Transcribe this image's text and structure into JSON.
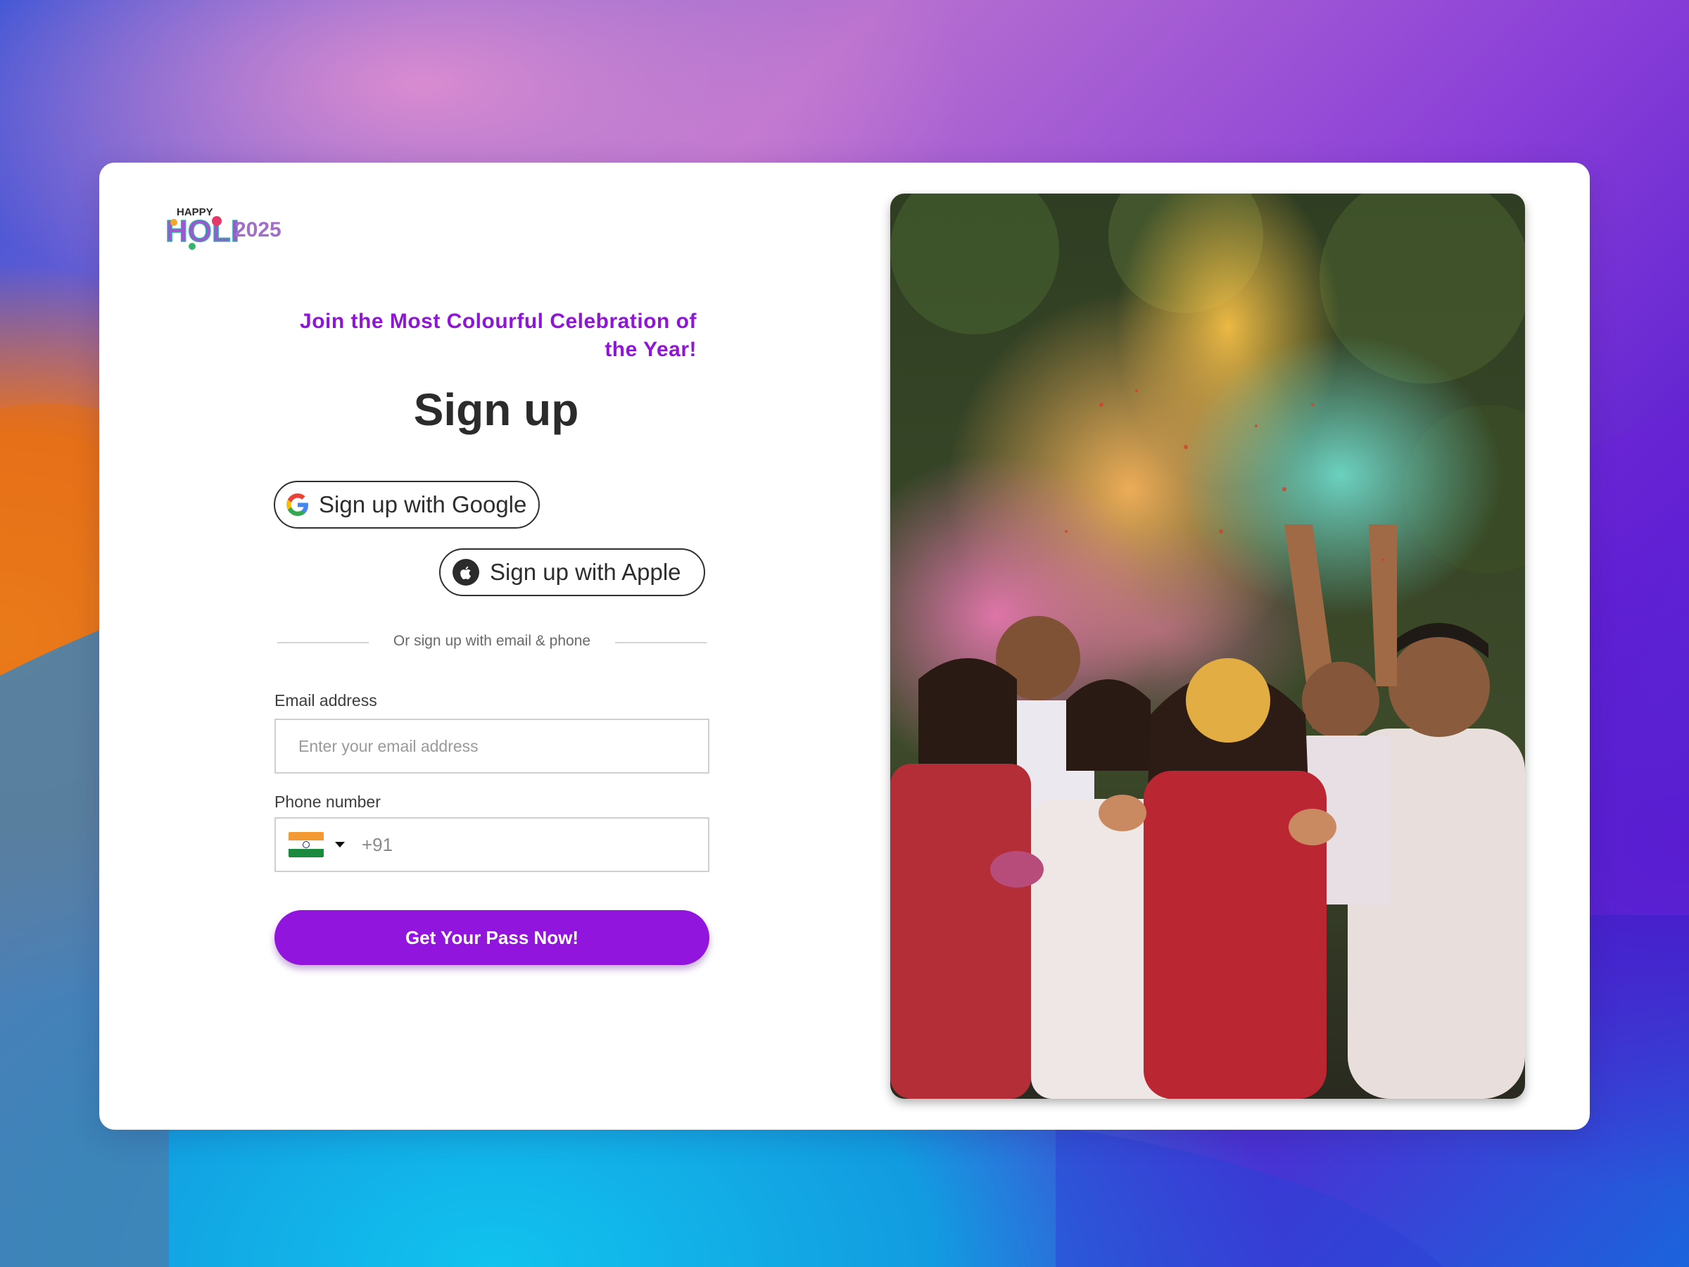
{
  "logo": {
    "happy_text": "HAPPY",
    "holi_text": "HOLI",
    "year_text": "2025"
  },
  "tagline": {
    "line1": "Join the Most Colourful Celebration of",
    "line2": "the Year!"
  },
  "title": "Sign up",
  "social": {
    "google_label": "Sign up with Google",
    "apple_label": "Sign up with Apple"
  },
  "divider_text": "Or sign up with email & phone",
  "email": {
    "label": "Email address",
    "placeholder": "Enter your email address",
    "value": ""
  },
  "phone": {
    "label": "Phone number",
    "country": "India",
    "dial_code": "+91",
    "value": ""
  },
  "cta_label": "Get Your Pass Now!",
  "photo": {
    "subject": "group-celebrating-holi-with-color-powder"
  },
  "colors": {
    "accent": "#9115dc",
    "tagline": "#8e16d6",
    "card_bg": "#ffffff",
    "text_dark": "#2b2b2b"
  }
}
